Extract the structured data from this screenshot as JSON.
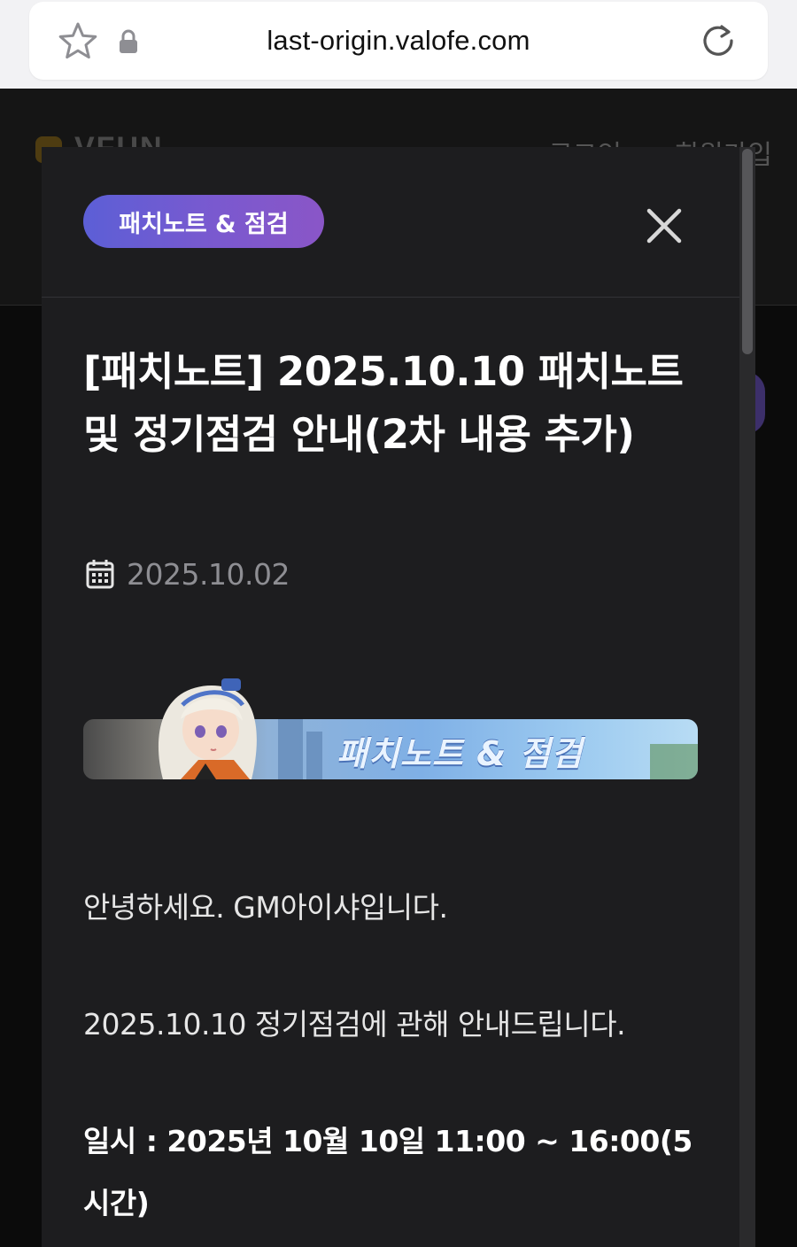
{
  "browser": {
    "url": "last-origin.valofe.com"
  },
  "background_page": {
    "logo_text": "VFUN",
    "nav": [
      "로그인",
      "회원가입"
    ]
  },
  "modal": {
    "category_label": "패치노트 & 점검",
    "title": "[패치노트] 2025.10.10 패치노트 및 정기점검 안내(2차 내용 추가)",
    "date": "2025.10.02",
    "banner_text": "패치노트 & 점검",
    "body": {
      "greeting": "안녕하세요. GM아이샤입니다.",
      "intro": "2025.10.10 정기점검에 관해 안내드립니다.",
      "schedule": "일시 : 2025년 10월 10일 11:00 ~ 16:00(5시간)"
    }
  },
  "colors": {
    "badge_gradient_start": "#5c5fd6",
    "badge_gradient_end": "#8a56c7",
    "modal_bg": "#1d1d1f",
    "date_color": "#8e8e93"
  },
  "icons": [
    "star-icon",
    "lock-icon",
    "reload-icon",
    "close-icon",
    "calendar-icon"
  ]
}
